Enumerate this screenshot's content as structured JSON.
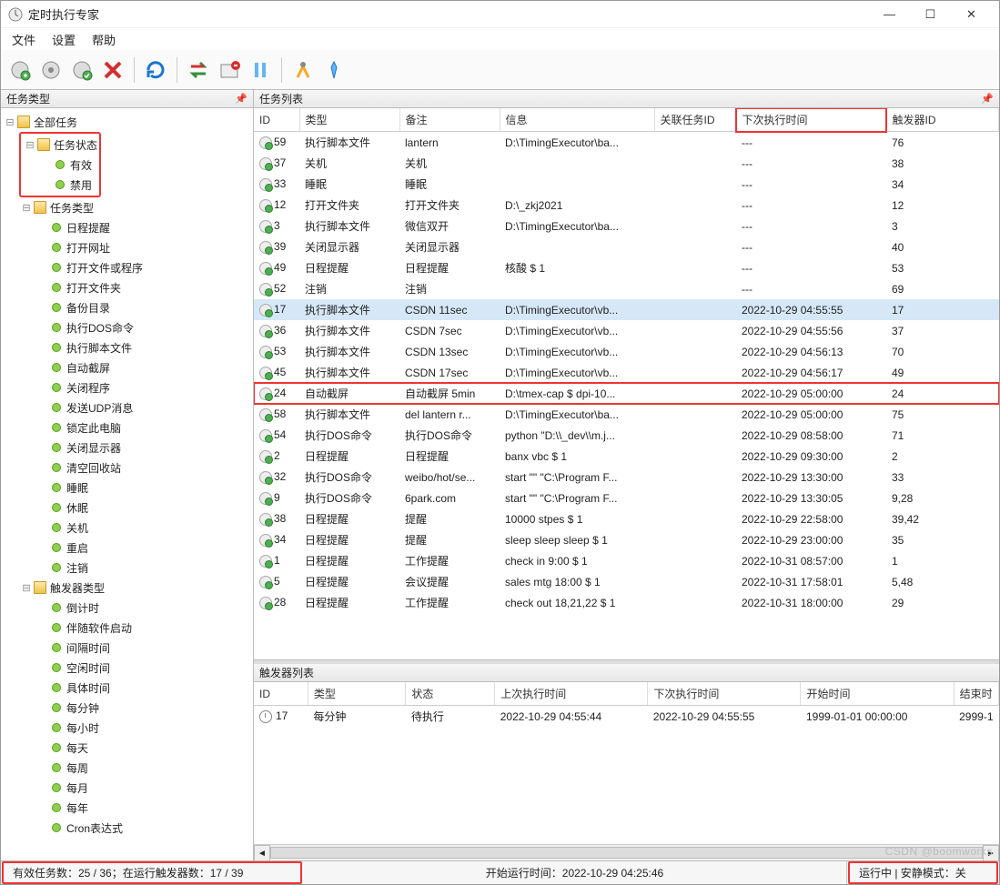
{
  "window": {
    "title": "定时执行专家"
  },
  "menu": [
    "文件",
    "设置",
    "帮助"
  ],
  "panes": {
    "left": "任务类型",
    "tasks": "任务列表",
    "triggers": "触发器列表"
  },
  "tree": {
    "root": "全部任务",
    "status": {
      "label": "任务状态",
      "items": [
        "有效",
        "禁用"
      ]
    },
    "taskType": {
      "label": "任务类型",
      "items": [
        "日程提醒",
        "打开网址",
        "打开文件或程序",
        "打开文件夹",
        "备份目录",
        "执行DOS命令",
        "执行脚本文件",
        "自动截屏",
        "关闭程序",
        "发送UDP消息",
        "锁定此电脑",
        "关闭显示器",
        "清空回收站",
        "睡眠",
        "休眠",
        "关机",
        "重启",
        "注销"
      ]
    },
    "trigType": {
      "label": "触发器类型",
      "items": [
        "倒计时",
        "伴随软件启动",
        "间隔时间",
        "空闲时间",
        "具体时间",
        "每分钟",
        "每小时",
        "每天",
        "每周",
        "每月",
        "每年",
        "Cron表达式"
      ]
    }
  },
  "taskCols": [
    "ID",
    "类型",
    "备注",
    "信息",
    "关联任务ID",
    "下次执行时间",
    "触发器ID"
  ],
  "tasks": [
    {
      "id": "59",
      "type": "执行脚本文件",
      "note": "lantern",
      "info": "D:\\TimingExecutor\\ba...",
      "rel": "",
      "next": "---",
      "tid": "76"
    },
    {
      "id": "37",
      "type": "关机",
      "note": "关机",
      "info": "",
      "rel": "",
      "next": "---",
      "tid": "38"
    },
    {
      "id": "33",
      "type": "睡眠",
      "note": "睡眠",
      "info": "",
      "rel": "",
      "next": "---",
      "tid": "34"
    },
    {
      "id": "12",
      "type": "打开文件夹",
      "note": "打开文件夹",
      "info": "D:\\_zkj2021",
      "rel": "",
      "next": "---",
      "tid": "12"
    },
    {
      "id": "3",
      "type": "执行脚本文件",
      "note": "微信双开",
      "info": "D:\\TimingExecutor\\ba...",
      "rel": "",
      "next": "---",
      "tid": "3"
    },
    {
      "id": "39",
      "type": "关闭显示器",
      "note": "关闭显示器",
      "info": "",
      "rel": "",
      "next": "---",
      "tid": "40"
    },
    {
      "id": "49",
      "type": "日程提醒",
      "note": "日程提醒",
      "info": "核酸 $ 1",
      "rel": "",
      "next": "---",
      "tid": "53"
    },
    {
      "id": "52",
      "type": "注销",
      "note": "注销",
      "info": "",
      "rel": "",
      "next": "---",
      "tid": "69"
    },
    {
      "id": "17",
      "type": "执行脚本文件",
      "note": "CSDN 11sec",
      "info": "D:\\TimingExecutor\\vb...",
      "rel": "",
      "next": "2022-10-29 04:55:55",
      "tid": "17",
      "sel": true
    },
    {
      "id": "36",
      "type": "执行脚本文件",
      "note": "CSDN 7sec",
      "info": "D:\\TimingExecutor\\vb...",
      "rel": "",
      "next": "2022-10-29 04:55:56",
      "tid": "37"
    },
    {
      "id": "53",
      "type": "执行脚本文件",
      "note": "CSDN 13sec",
      "info": "D:\\TimingExecutor\\vb...",
      "rel": "",
      "next": "2022-10-29 04:56:13",
      "tid": "70"
    },
    {
      "id": "45",
      "type": "执行脚本文件",
      "note": "CSDN 17sec",
      "info": "D:\\TimingExecutor\\vb...",
      "rel": "",
      "next": "2022-10-29 04:56:17",
      "tid": "49"
    },
    {
      "id": "24",
      "type": "自动截屏",
      "note": "自动截屏 5min",
      "info": "D:\\tmex-cap $ dpi-10...",
      "rel": "",
      "next": "2022-10-29 05:00:00",
      "tid": "24",
      "hl": true
    },
    {
      "id": "58",
      "type": "执行脚本文件",
      "note": "del lantern r...",
      "info": "D:\\TimingExecutor\\ba...",
      "rel": "",
      "next": "2022-10-29 05:00:00",
      "tid": "75"
    },
    {
      "id": "54",
      "type": "执行DOS命令",
      "note": "执行DOS命令",
      "info": "python \"D:\\\\_dev\\\\m.j...",
      "rel": "",
      "next": "2022-10-29 08:58:00",
      "tid": "71"
    },
    {
      "id": "2",
      "type": "日程提醒",
      "note": "日程提醒",
      "info": "banx vbc $ 1",
      "rel": "",
      "next": "2022-10-29 09:30:00",
      "tid": "2"
    },
    {
      "id": "32",
      "type": "执行DOS命令",
      "note": "weibo/hot/se...",
      "info": "start \"\" \"C:\\Program F...",
      "rel": "",
      "next": "2022-10-29 13:30:00",
      "tid": "33"
    },
    {
      "id": "9",
      "type": "执行DOS命令",
      "note": "6park.com",
      "info": "start \"\" \"C:\\Program F...",
      "rel": "",
      "next": "2022-10-29 13:30:05",
      "tid": "9,28"
    },
    {
      "id": "38",
      "type": "日程提醒",
      "note": "提醒",
      "info": "10000 stpes $ 1",
      "rel": "",
      "next": "2022-10-29 22:58:00",
      "tid": "39,42"
    },
    {
      "id": "34",
      "type": "日程提醒",
      "note": "提醒",
      "info": "sleep sleep sleep $ 1",
      "rel": "",
      "next": "2022-10-29 23:00:00",
      "tid": "35"
    },
    {
      "id": "1",
      "type": "日程提醒",
      "note": "工作提醒",
      "info": "check in 9:00 $ 1",
      "rel": "",
      "next": "2022-10-31 08:57:00",
      "tid": "1"
    },
    {
      "id": "5",
      "type": "日程提醒",
      "note": "会议提醒",
      "info": "sales mtg 18:00 $ 1",
      "rel": "",
      "next": "2022-10-31 17:58:01",
      "tid": "5,48"
    },
    {
      "id": "28",
      "type": "日程提醒",
      "note": "工作提醒",
      "info": "check out 18,21,22 $ 1",
      "rel": "",
      "next": "2022-10-31 18:00:00",
      "tid": "29"
    }
  ],
  "trigCols": [
    "ID",
    "类型",
    "状态",
    "上次执行时间",
    "下次执行时间",
    "开始时间",
    "结束时"
  ],
  "triggers": [
    {
      "id": "17",
      "type": "每分钟",
      "status": "待执行",
      "last": "2022-10-29 04:55:44",
      "next": "2022-10-29 04:55:55",
      "start": "1999-01-01 00:00:00",
      "end": "2999-1"
    }
  ],
  "status": {
    "left": "有效任务数：25 / 36；在运行触发器数：17 / 39",
    "mid_label": "开始运行时间：",
    "mid_val": "2022-10-29 04:25:46",
    "right": "运行中 | 安静模式：关"
  },
  "watermark": "CSDN @boomworks"
}
